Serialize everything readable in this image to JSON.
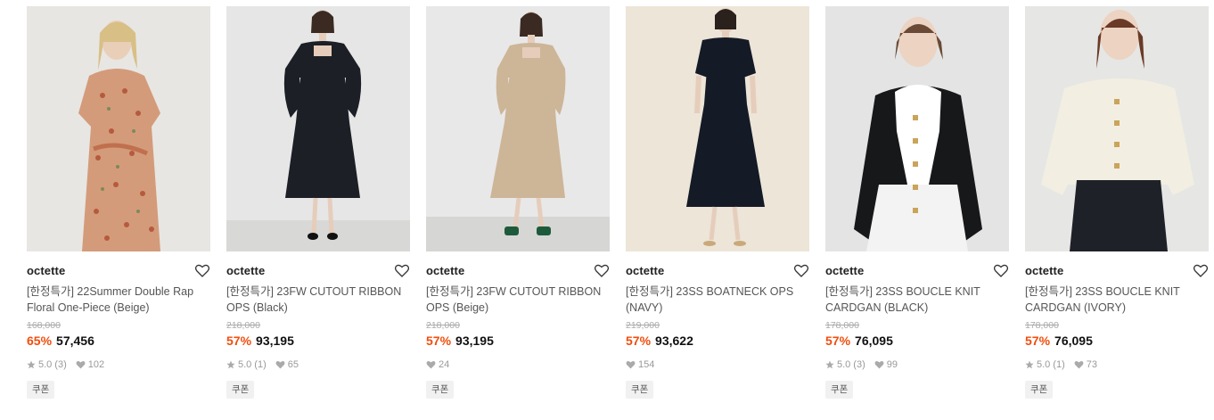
{
  "products": [
    {
      "brand": "octette",
      "title": "[한정특가] 22Summer Double Rap Floral One-Piece (Beige)",
      "original_price": "168,000",
      "discount": "65%",
      "price": "57,456",
      "rating": "5.0",
      "reviews": "(3)",
      "likes": "102",
      "has_rating": true,
      "coupon": "쿠폰",
      "image_icon": "floral-dress-photo",
      "colors": {
        "bg": "#e6e6e4",
        "garment": "#d49b7a",
        "pattern": "#b55a3e"
      }
    },
    {
      "brand": "octette",
      "title": "[한정특가] 23FW CUTOUT RIBBON OPS (Black)",
      "original_price": "218,000",
      "discount": "57%",
      "price": "93,195",
      "rating": "5.0",
      "reviews": "(1)",
      "likes": "65",
      "has_rating": true,
      "coupon": "쿠폰",
      "image_icon": "black-dress-photo",
      "colors": {
        "bg": "#e8e8e8",
        "garment": "#1c1f26",
        "pattern": "#1c1f26"
      }
    },
    {
      "brand": "octette",
      "title": "[한정특가] 23FW CUTOUT RIBBON OPS (Beige)",
      "original_price": "218,000",
      "discount": "57%",
      "price": "93,195",
      "rating": "",
      "reviews": "",
      "likes": "24",
      "has_rating": false,
      "coupon": "쿠폰",
      "image_icon": "beige-dress-photo",
      "colors": {
        "bg": "#e8e8e8",
        "garment": "#cdb598",
        "pattern": "#cdb598"
      }
    },
    {
      "brand": "octette",
      "title": "[한정특가] 23SS BOATNECK OPS (NAVY)",
      "original_price": "219,000",
      "discount": "57%",
      "price": "93,622",
      "rating": "",
      "reviews": "",
      "likes": "154",
      "has_rating": false,
      "coupon": "쿠폰",
      "image_icon": "navy-dress-photo",
      "colors": {
        "bg": "#ece5d8",
        "garment": "#141a26",
        "pattern": "#141a26"
      }
    },
    {
      "brand": "octette",
      "title": "[한정특가] 23SS BOUCLE KNIT CARDGAN (BLACK)",
      "original_price": "178,000",
      "discount": "57%",
      "price": "76,095",
      "rating": "5.0",
      "reviews": "(3)",
      "likes": "99",
      "has_rating": true,
      "coupon": "쿠폰",
      "image_icon": "black-cardigan-photo",
      "colors": {
        "bg": "#e4e4e4",
        "garment": "#17181a",
        "pattern": "#ffffff"
      }
    },
    {
      "brand": "octette",
      "title": "[한정특가] 23SS BOUCLE KNIT CARDGAN (IVORY)",
      "original_price": "178,000",
      "discount": "57%",
      "price": "76,095",
      "rating": "5.0",
      "reviews": "(1)",
      "likes": "73",
      "has_rating": true,
      "coupon": "쿠폰",
      "image_icon": "ivory-cardigan-photo",
      "colors": {
        "bg": "#e6e6e4",
        "garment": "#f2eee2",
        "pattern": "#1f2128"
      }
    }
  ],
  "colors": {
    "discount": "#f04e0e",
    "muted": "#999999"
  }
}
